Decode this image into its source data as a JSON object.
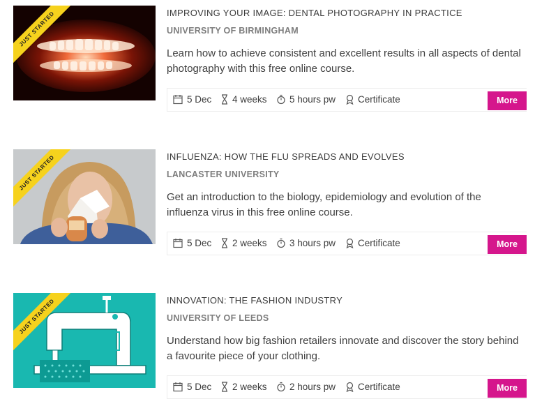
{
  "ribbon_label": "Just started",
  "more_label": "More",
  "colors": {
    "accent": "#d5168c",
    "ribbon": "#f6d21d"
  },
  "courses": [
    {
      "title": "IMPROVING YOUR IMAGE: DENTAL PHOTOGRAPHY IN PRACTICE",
      "university": "UNIVERSITY OF BIRMINGHAM",
      "description": "Learn how to achieve consistent and excellent results in all aspects of dental photography with this free online course.",
      "start": "5 Dec",
      "duration": "4 weeks",
      "effort": "5 hours pw",
      "certificate": "Certificate",
      "thumbnail": "teeth-xray-image"
    },
    {
      "title": "INFLUENZA: HOW THE FLU SPREADS AND EVOLVES",
      "university": "LANCASTER UNIVERSITY",
      "description": "Get an introduction to the biology, epidemiology and evolution of the influenza virus in this free online course.",
      "start": "5 Dec",
      "duration": "2 weeks",
      "effort": "3 hours pw",
      "certificate": "Certificate",
      "thumbnail": "woman-sneezing-image"
    },
    {
      "title": "INNOVATION: THE FASHION INDUSTRY",
      "university": "UNIVERSITY OF LEEDS",
      "description": "Understand how big fashion retailers innovate and discover the story behind a favourite piece of your clothing.",
      "start": "5 Dec",
      "duration": "2 weeks",
      "effort": "2 hours pw",
      "certificate": "Certificate",
      "thumbnail": "sewing-machine-image"
    }
  ]
}
